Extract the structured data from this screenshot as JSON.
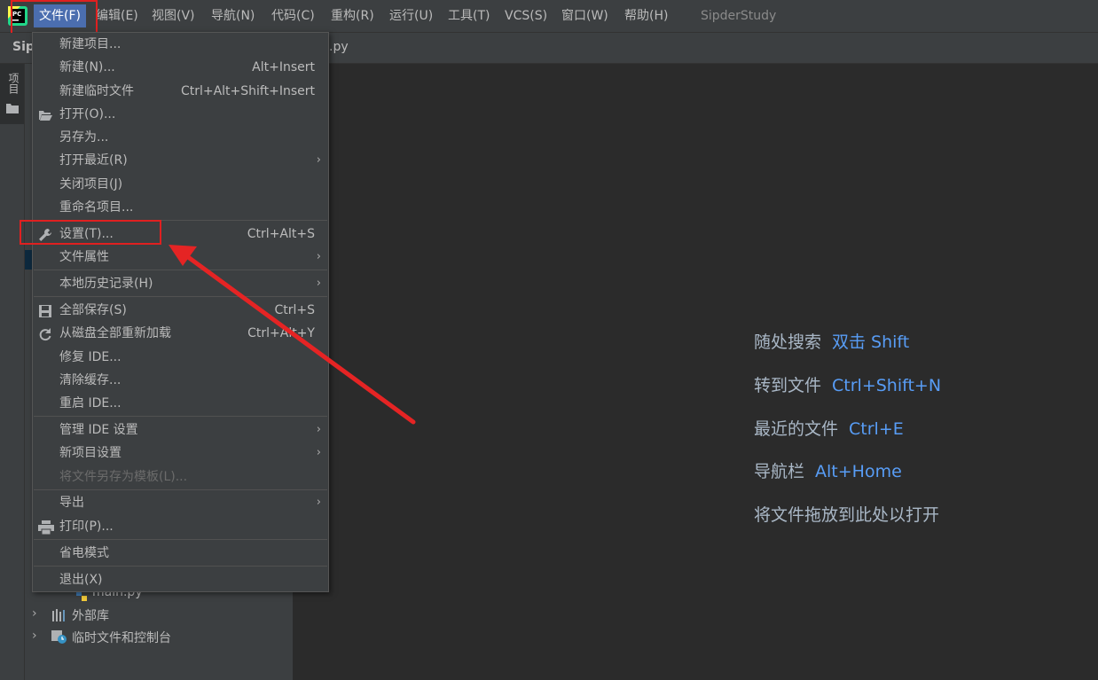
{
  "menubar": {
    "items": [
      "文件(F)",
      "编辑(E)",
      "视图(V)",
      "导航(N)",
      "代码(C)",
      "重构(R)",
      "运行(U)",
      "工具(T)",
      "VCS(S)",
      "窗口(W)",
      "帮助(H)"
    ],
    "project_title": "SipderStudy"
  },
  "navbar": {
    "project_prefix": "Sip",
    "file_tab_suffix": ".py"
  },
  "left_strip": {
    "project_tab": "项目"
  },
  "file_menu": {
    "items": [
      {
        "label": "新建项目...",
        "shortcut": ""
      },
      {
        "label": "新建(N)...",
        "shortcut": "Alt+Insert"
      },
      {
        "label": "新建临时文件",
        "shortcut": "Ctrl+Alt+Shift+Insert"
      },
      {
        "label": "打开(O)...",
        "shortcut": ""
      },
      {
        "label": "另存为...",
        "shortcut": ""
      },
      {
        "label": "打开最近(R)",
        "shortcut": ""
      },
      {
        "label": "关闭项目(J)",
        "shortcut": ""
      },
      {
        "label": "重命名项目...",
        "shortcut": ""
      },
      {
        "label": "设置(T)...",
        "shortcut": "Ctrl+Alt+S"
      },
      {
        "label": "文件属性",
        "shortcut": ""
      },
      {
        "label": "本地历史记录(H)",
        "shortcut": ""
      },
      {
        "label": "全部保存(S)",
        "shortcut": "Ctrl+S"
      },
      {
        "label": "从磁盘全部重新加载",
        "shortcut": "Ctrl+Alt+Y"
      },
      {
        "label": "修复 IDE...",
        "shortcut": ""
      },
      {
        "label": "清除缓存...",
        "shortcut": ""
      },
      {
        "label": "重启 IDE...",
        "shortcut": ""
      },
      {
        "label": "管理 IDE 设置",
        "shortcut": ""
      },
      {
        "label": "新项目设置",
        "shortcut": ""
      },
      {
        "label": "将文件另存为模板(L)...",
        "shortcut": ""
      },
      {
        "label": "导出",
        "shortcut": ""
      },
      {
        "label": "打印(P)...",
        "shortcut": ""
      },
      {
        "label": "省电模式",
        "shortcut": ""
      },
      {
        "label": "退出(X)",
        "shortcut": ""
      }
    ],
    "submenu_arrow": "›"
  },
  "project_tree": {
    "items": [
      "main.py",
      "外部库",
      "临时文件和控制台"
    ],
    "expand_glyph": "›"
  },
  "editor_hints": [
    {
      "text": "随处搜索",
      "key": "双击 Shift"
    },
    {
      "text": "转到文件",
      "key": "Ctrl+Shift+N"
    },
    {
      "text": "最近的文件",
      "key": "Ctrl+E"
    },
    {
      "text": "导航栏",
      "key": "Alt+Home"
    },
    {
      "text": "将文件拖放到此处以打开",
      "key": ""
    }
  ],
  "colors": {
    "accent": "#4b6eaf",
    "highlight_box": "#e02020",
    "hint_key": "#589df6"
  }
}
